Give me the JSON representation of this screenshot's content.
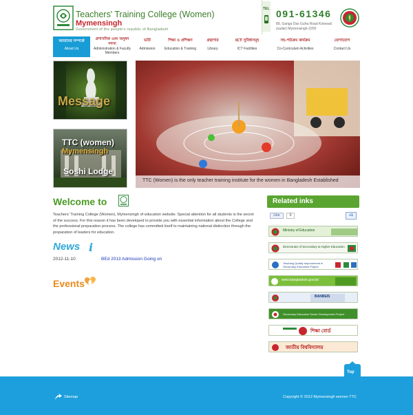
{
  "header": {
    "college_name": "Teachers' Training College (Women)",
    "city": "Mymensingh",
    "government": "Government of the people's republic of Bangladesh",
    "tel_label": "TEL",
    "phone": "091-61346",
    "address_line1": "89, Ganga Das Guha Road Kotowali",
    "address_line2": "(sadar) Mymensingh-2200"
  },
  "nav": {
    "items": [
      {
        "bn": "আমাদের সম্পর্কে",
        "en": "About Us"
      },
      {
        "bn": "প্রশাসনিক এবং অনুষদ সদস্য",
        "en": "Administration & Faculty Members"
      },
      {
        "bn": "ভর্তি",
        "en": "Admission"
      },
      {
        "bn": "শিক্ষা ও প্রশিক্ষণ",
        "en": "Education & Training"
      },
      {
        "bn": "গ্রন্থাগার",
        "en": "Library"
      },
      {
        "bn": "ICT সুবিধাসমূহ",
        "en": "ICT Facilities"
      },
      {
        "bn": "সহ-পাঠক্রম কার্যক্রম",
        "en": "Co-Curriculum Activities"
      },
      {
        "bn": "যোগাযোগ",
        "en": "Contact Us"
      }
    ]
  },
  "promos": {
    "message": "Message",
    "ttc_line1": "TTC (women)",
    "ttc_line2": "Mymensingh",
    "ttc_line3": "Soshi Lodge"
  },
  "slider": {
    "caption": "TTC (Women) is the only teacher training institute for the women in Bangladesh Established"
  },
  "welcome": {
    "heading": "Welcome to",
    "text": "Teachers' Training College (Women), Mymensingh of education website. Special attention for all students is the secret of the success. For this reason it has been developed to provide you with essential information about the College and the professional preparation process. The college has committed itself to maintaining national distinction through the preparation of leaders for education."
  },
  "news": {
    "heading": "News",
    "items": [
      {
        "date": "2012-11-10",
        "title": "BEd 2013 Admission Going on"
      }
    ]
  },
  "events": {
    "heading": "Events"
  },
  "related": {
    "title": "Related inks",
    "like_label": "Like",
    "like_count": "0",
    "plus_label": "+1",
    "links": [
      {
        "text": "Ministry of Education",
        "color": "#1a5c1a"
      },
      {
        "text": "Directorate of Secondary & Higher Education",
        "color": "#1a5c1a"
      },
      {
        "text": "Teaching Quality Improvement in Secondary Education Project",
        "color": "#2a4a8a"
      },
      {
        "text": "www.bangladesh.gov.bd",
        "color": "#ffffff"
      },
      {
        "text": "BANBEIS",
        "color": "#1a3a7a"
      },
      {
        "text": "Secondary Education Sector Development Project",
        "color": "#ffffff"
      },
      {
        "text": "শিক্ষা বোর্ড",
        "color": "#b01818"
      },
      {
        "text": "জাতীয় বিশ্ববিদ্যালয়",
        "color": "#b01818"
      }
    ]
  },
  "footer": {
    "top_label": "Top",
    "sitemap": "Sitemap",
    "copyright": "Copyright © 2012 Mymensingh women TTC"
  },
  "colors": {
    "brand_green": "#4a9a23",
    "nav_active": "#189cd6",
    "footer_blue": "#1c9fdc",
    "title_red": "#c4262e",
    "events_orange": "#e88a1a"
  }
}
